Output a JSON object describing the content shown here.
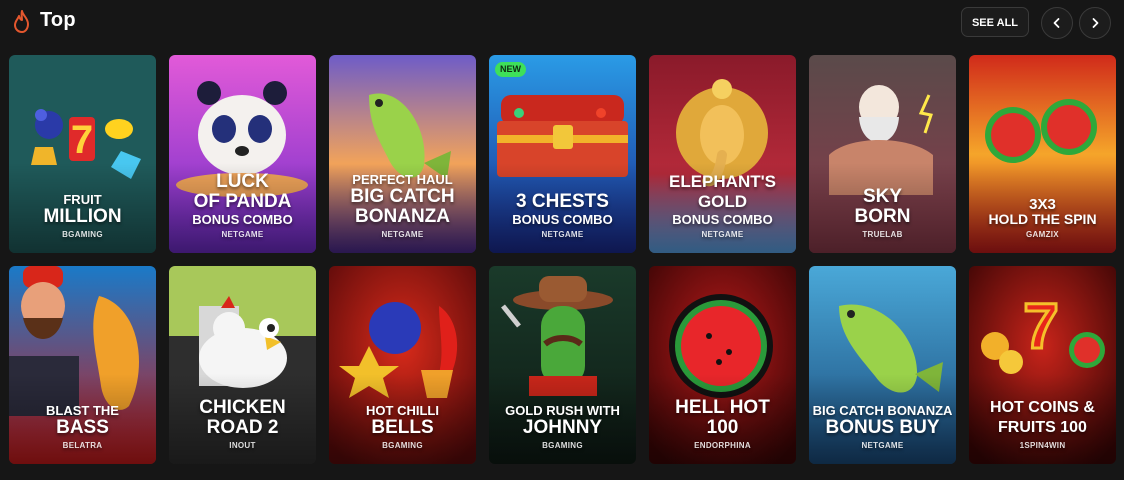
{
  "header": {
    "title": "Top",
    "see_all_label": "SEE ALL"
  },
  "colors": {
    "accent_fire": "#e4572e",
    "background": "#161616"
  },
  "badge_new": "NEW",
  "games": [
    {
      "line1": "FRUIT",
      "line2": "MILLION",
      "line3": "",
      "provider": "BGAMING"
    },
    {
      "line1": "",
      "line2": "LUCK\nOF PANDA",
      "line3": "BONUS COMBO",
      "provider": "NETGAME"
    },
    {
      "line1": "PERFECT HAUL",
      "line2": "BIG CATCH\nBONANZA",
      "line3": "",
      "provider": "NETGAME"
    },
    {
      "line1": "",
      "line2": "3 CHESTS",
      "line3": "BONUS COMBO",
      "provider": "NETGAME"
    },
    {
      "line1": "",
      "line2": "ELEPHANT'S\nGOLD",
      "line3": "BONUS COMBO",
      "provider": "NETGAME"
    },
    {
      "line1": "",
      "line2": "SKY\nBORN",
      "line3": "",
      "provider": "TRUELAB"
    },
    {
      "line1": "3X3",
      "line2": "",
      "line3": "HOLD THE SPIN",
      "provider": "GAMZIX"
    },
    {
      "line1": "BLAST THE",
      "line2": "BASS",
      "line3": "",
      "provider": "BELATRA"
    },
    {
      "line1": "",
      "line2": "CHICKEN\nROAD 2",
      "line3": "",
      "provider": "INOUT"
    },
    {
      "line1": "HOT CHILLI",
      "line2": "BELLS",
      "line3": "",
      "provider": "BGAMING"
    },
    {
      "line1": "GOLD RUSH WITH",
      "line2": "JOHNNY",
      "line3": "",
      "provider": "BGAMING"
    },
    {
      "line1": "",
      "line2": "HELL HOT\n100",
      "line3": "",
      "provider": "ENDORPHINA"
    },
    {
      "line1": "BIG CATCH BONANZA",
      "line2": "BONUS BUY",
      "line3": "",
      "provider": "NETGAME"
    },
    {
      "line1": "",
      "line2": "HOT COINS &\nFRUITS 100",
      "line3": "",
      "provider": "1SPIN4WIN"
    }
  ]
}
